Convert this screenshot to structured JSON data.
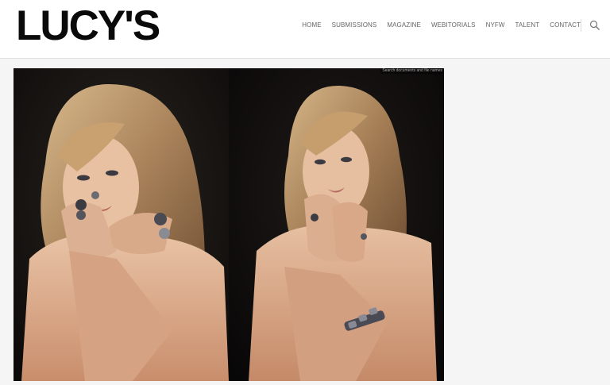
{
  "brand": {
    "logo_text": "LUCY'S"
  },
  "nav": {
    "items": [
      {
        "label": "HOME"
      },
      {
        "label": "SUBMISSIONS"
      },
      {
        "label": "MAGAZINE"
      },
      {
        "label": "WEBITORIALS"
      },
      {
        "label": "NYFW"
      },
      {
        "label": "TALENT"
      },
      {
        "label": "CONTACT"
      }
    ],
    "search_icon": "search-icon"
  },
  "gallery": {
    "overlay_text": "Search documents and file names",
    "images": [
      {
        "description": "editorial-photo-1"
      },
      {
        "description": "editorial-photo-2"
      }
    ]
  },
  "colors": {
    "header_bg": "#ffffff",
    "page_bg": "#f5f5f5",
    "logo": "#0a0a0a",
    "nav_text": "#666666"
  }
}
